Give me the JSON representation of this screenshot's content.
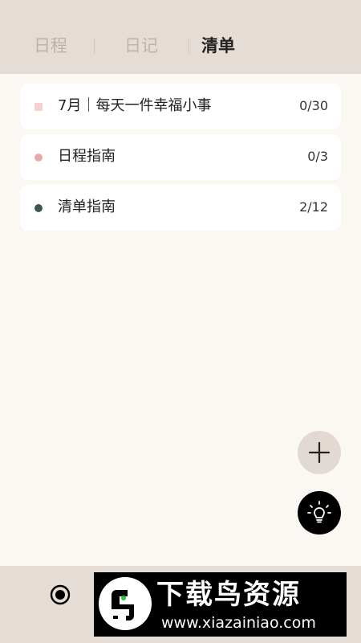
{
  "tabs": [
    {
      "label": "日程",
      "active": false
    },
    {
      "label": "日记",
      "active": false
    },
    {
      "label": "清单",
      "active": true
    }
  ],
  "lists": [
    {
      "title": "7月｜每天一件幸福小事",
      "count": "0/30",
      "color": "#f6cfcf",
      "shape": "square"
    },
    {
      "title": "日程指南",
      "count": "0/3",
      "color": "#e9a9ae",
      "shape": "circle"
    },
    {
      "title": "清单指南",
      "count": "2/12",
      "color": "#3e5a4f",
      "shape": "circle"
    }
  ],
  "buttons": {
    "add": "plus-icon",
    "idea": "lightbulb-icon"
  },
  "watermark": {
    "title": "下载鸟资源",
    "url": "www.xiazainiao.com"
  },
  "colors": {
    "header_bg": "#e6dcd6",
    "page_bg": "#fbf7f2",
    "tab_inactive": "#bdb3ad",
    "tab_active": "#222222"
  }
}
